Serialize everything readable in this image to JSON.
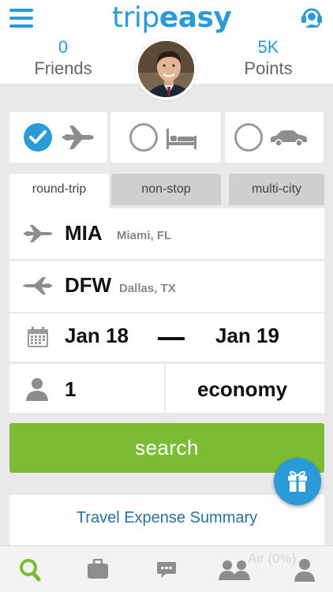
{
  "header": {
    "logo_trip": "trip",
    "logo_easy": "easy",
    "menu_icon": "hamburger-menu-icon",
    "support_icon": "headset-support-icon"
  },
  "stats": {
    "friends": {
      "count": "0",
      "label": "Friends"
    },
    "points": {
      "count": "5K",
      "label": "Points"
    }
  },
  "travel_modes": [
    {
      "icon": "airplane-icon",
      "selected": true
    },
    {
      "icon": "bed-icon",
      "selected": false
    },
    {
      "icon": "car-icon",
      "selected": false
    }
  ],
  "trip_tabs": [
    {
      "label": "round-trip",
      "active": true
    },
    {
      "label": "non-stop",
      "active": false
    },
    {
      "label": "multi-city",
      "active": false
    }
  ],
  "origin": {
    "code": "MIA",
    "city": "Miami, FL"
  },
  "destination": {
    "code": "DFW",
    "city": "Dallas, TX"
  },
  "dates": {
    "depart": "Jan 18",
    "return": "Jan 19"
  },
  "passengers": {
    "count": "1",
    "cabin": "economy"
  },
  "search_label": "search",
  "summary_label": "Travel Expense Summary",
  "ghost_text": "Air (0%)",
  "bottom_nav": [
    {
      "icon": "search-icon",
      "active": true
    },
    {
      "icon": "briefcase-icon",
      "active": false
    },
    {
      "icon": "chat-icon",
      "active": false
    },
    {
      "icon": "friends-icon",
      "active": false
    },
    {
      "icon": "profile-icon",
      "active": false
    }
  ],
  "colors": {
    "accent_blue": "#2a9bd8",
    "search_green": "#7cbc33",
    "background": "#e9e9e9",
    "tab_inactive": "#cfcfcf"
  }
}
